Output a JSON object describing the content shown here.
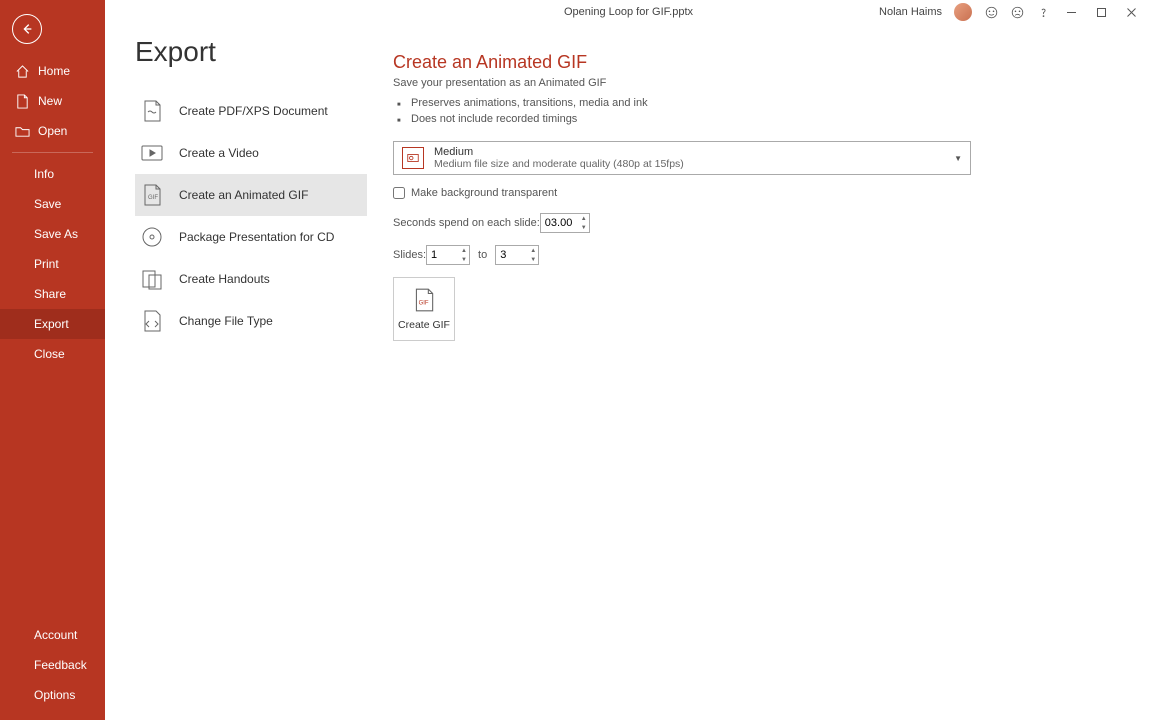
{
  "titlebar": {
    "filename": "Opening Loop for GIF.pptx",
    "username": "Nolan Haims"
  },
  "sidebar": {
    "home": "Home",
    "new": "New",
    "open": "Open",
    "info": "Info",
    "save": "Save",
    "saveas": "Save As",
    "print": "Print",
    "share": "Share",
    "export": "Export",
    "close": "Close",
    "account": "Account",
    "feedback": "Feedback",
    "options": "Options"
  },
  "page_title": "Export",
  "export_items": {
    "pdf": "Create PDF/XPS Document",
    "video": "Create a Video",
    "gif": "Create an Animated GIF",
    "cd": "Package Presentation for CD",
    "handouts": "Create Handouts",
    "filetype": "Change File Type"
  },
  "detail": {
    "heading": "Create an Animated GIF",
    "subtitle": "Save your presentation as an Animated GIF",
    "bullet1": "Preserves animations, transitions, media and ink",
    "bullet2": "Does not include recorded timings",
    "quality_title": "Medium",
    "quality_sub": "Medium file size and moderate quality (480p at 15fps)",
    "transparent_label": "Make background transparent",
    "seconds_label": "Seconds spend on each slide:",
    "seconds_value": "03.00",
    "slides_label": "Slides:",
    "slides_from": "1",
    "slides_to_word": "to",
    "slides_to": "3",
    "create_gif": "Create GIF"
  }
}
